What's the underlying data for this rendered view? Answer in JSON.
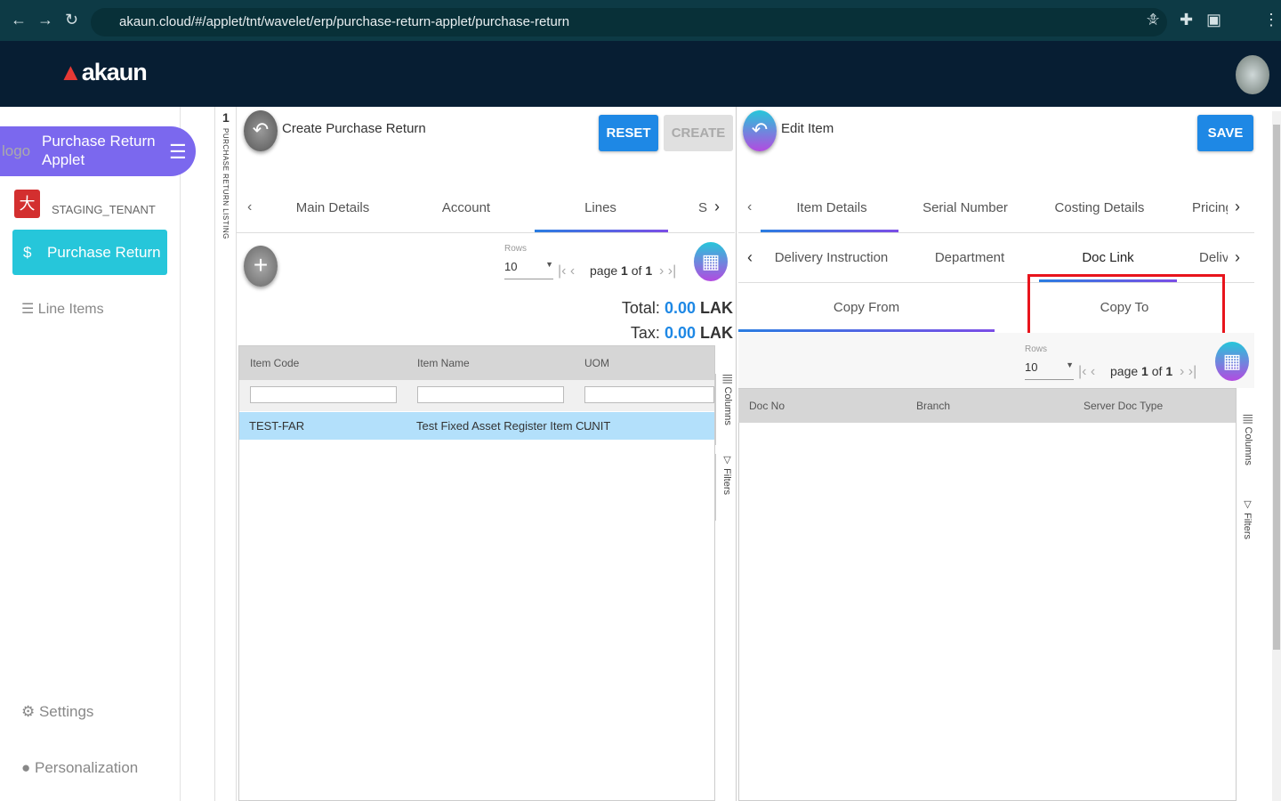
{
  "browser": {
    "url": "akaun.cloud/#/applet/tnt/wavelet/erp/purchase-return-applet/purchase-return"
  },
  "app": {
    "logo": "akaun"
  },
  "sidebar": {
    "logo_alt": "logo",
    "applet_title": "Purchase Return Applet",
    "tenant": "STAGING_TENANT",
    "items": [
      {
        "label": "Purchase Return"
      },
      {
        "label": "Line Items"
      }
    ],
    "settings": "Settings",
    "personalization": "Personalization"
  },
  "listing": {
    "count": "1",
    "label": "PURCHASE RETURN LISTING"
  },
  "create_panel": {
    "title": "Create Purchase Return",
    "reset": "RESET",
    "create": "CREATE",
    "tabs": [
      "Main Details",
      "Account",
      "Lines",
      "S"
    ],
    "active_tab": "Lines",
    "rows_label": "Rows",
    "rows_value": "10",
    "page_prefix": "page",
    "page": "1",
    "of": "of",
    "total_pages": "1",
    "total_label": "Total:",
    "total_value": "0.00",
    "tax_label": "Tax:",
    "tax_value": "0.00",
    "currency": "LAK",
    "columns": [
      "Item Code",
      "Item Name",
      "UOM"
    ],
    "rows": [
      [
        "TEST-FAR",
        "Test Fixed Asset Register Item C...",
        "UNIT"
      ]
    ],
    "columns_btn": "Columns",
    "filters_btn": "Filters"
  },
  "edit_panel": {
    "title": "Edit Item",
    "save": "SAVE",
    "tabs1": [
      "Item Details",
      "Serial Number",
      "Costing Details",
      "Pricing"
    ],
    "tabs2": [
      "Delivery Instruction",
      "Department",
      "Doc Link",
      "Deliv"
    ],
    "subtabs": [
      "Copy From",
      "Copy To"
    ],
    "rows_label": "Rows",
    "rows_value": "10",
    "page_prefix": "page",
    "page": "1",
    "of": "of",
    "total_pages": "1",
    "columns": [
      "Doc No",
      "Branch",
      "Server Doc Type"
    ],
    "columns_btn": "Columns",
    "filters_btn": "Filters"
  },
  "colors": {
    "accent": "#7b68ee",
    "primary": "#1e88e5",
    "teal": "#26c6da",
    "highlight": "#e8141c",
    "selected_row": "#b3e0fb"
  }
}
